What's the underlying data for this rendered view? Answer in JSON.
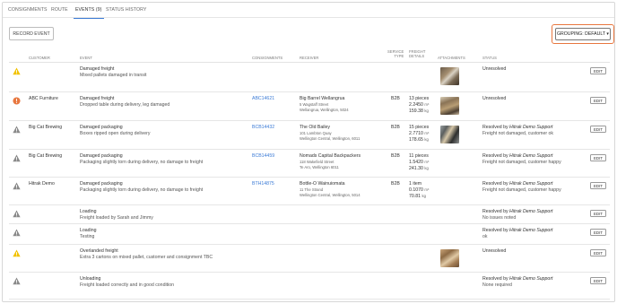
{
  "tabs": [
    {
      "label": "CONSIGNMENTS"
    },
    {
      "label": "ROUTE"
    },
    {
      "label": "EVENTS (9)"
    },
    {
      "label": "STATUS HISTORY"
    }
  ],
  "toolbar": {
    "record_event_label": "RECORD EVENT",
    "grouping_label": "GROUPING: DEFAULT ▾"
  },
  "columns": {
    "customer": "CUSTOMER",
    "event": "EVENT",
    "consignments": "CONSIGNMENTS",
    "receiver": "RECEIVER",
    "service_type_1": "SERVICE",
    "service_type_2": "TYPE",
    "freight_details_1": "FREIGHT",
    "freight_details_2": "DETAILS",
    "attachments": "ATTACHMENTS",
    "status": "STATUS"
  },
  "colors": {
    "warning": "#f2c200",
    "error": "#e8773f",
    "neutral": "#8a8a8a",
    "link": "#3b7bd6",
    "highlight": "#e8773f"
  },
  "edit_label": "EDIT",
  "rows": [
    {
      "icon": "warning-icon",
      "customer": "",
      "event_title": "Damaged freight",
      "event_desc": "Mixed pallets damaged in transit",
      "consignment": "",
      "receiver_name": "",
      "receiver_line1": "",
      "receiver_line2": "",
      "service_type": "",
      "freight_pieces": "",
      "freight_volume": "",
      "freight_weight": "",
      "has_attachment": true,
      "status_line1": "Unresolved",
      "status_line2": ""
    },
    {
      "icon": "error-icon",
      "customer": "ABC Furniture",
      "event_title": "Damaged freight",
      "event_desc": "Dropped table during delivery, leg damaged",
      "consignment": "ABC14621",
      "receiver_name": "Big Barrel Wellangrua",
      "receiver_line1": "5 Wagstaff Street",
      "receiver_line2": "Wellangrua, Wellington, 5024",
      "service_type": "B2B",
      "freight_pieces": "13 pieces",
      "freight_volume": "2.2450",
      "freight_weight": "159.38",
      "has_attachment": true,
      "status_line1": "Unresolved",
      "status_line2": ""
    },
    {
      "icon": "neutral-icon",
      "customer": "Big Cat Brewing",
      "event_title": "Damaged packaging",
      "event_desc": "Boxes ripped open during delivery",
      "consignment": "BCB14432",
      "receiver_name": "The Old Bailey",
      "receiver_line1": "101 Lambton Quay",
      "receiver_line2": "Wellington Central, Wellington, 6011",
      "service_type": "B2B",
      "freight_pieces": "15 pieces",
      "freight_volume": "2.7710",
      "freight_weight": "178.65",
      "has_attachment": true,
      "status_line1": "Resolved by",
      "status_by": "Hitrak Demo Support",
      "status_line2": "Freight not damaged, customer ok"
    },
    {
      "icon": "neutral-icon",
      "customer": "Big Cat Brewing",
      "event_title": "Damaged packaging",
      "event_desc": "Packaging slightly torn during delivery, no damage to freight",
      "consignment": "BCB14459",
      "receiver_name": "Nomads Capital Backpackers",
      "receiver_line1": "118 Wakefield Street",
      "receiver_line2": "Te Aro, Wellington 6011",
      "service_type": "B2B",
      "freight_pieces": "11 pieces",
      "freight_volume": "1.5420",
      "freight_weight": "241.30",
      "has_attachment": false,
      "status_line1": "Resolved by",
      "status_by": "Hitrak Demo Support",
      "status_line2": "Freight not damaged, customer happy"
    },
    {
      "icon": "neutral-icon",
      "customer": "Hitrak Demo",
      "event_title": "Damaged packaging",
      "event_desc": "Packaging slightly torn during delivery, no damage to freight",
      "consignment": "BTH14875",
      "receiver_name": "Bottle-O Wainuiomata",
      "receiver_line1": "11 The Strand",
      "receiver_line2": "Wellington Central, Wellington, 5014",
      "service_type": "B2B",
      "freight_pieces": "1 item",
      "freight_volume": "0.1070",
      "freight_weight": "70.81",
      "has_attachment": false,
      "status_line1": "Resolved by",
      "status_by": "Hitrak Demo Support",
      "status_line2": "Freight not damaged, customer happy"
    },
    {
      "icon": "neutral-icon",
      "customer": "",
      "event_title": "Loading",
      "event_desc": "Freight loaded by Sarah and Jimmy",
      "consignment": "",
      "receiver_name": "",
      "receiver_line1": "",
      "receiver_line2": "",
      "service_type": "",
      "freight_pieces": "",
      "freight_volume": "",
      "freight_weight": "",
      "has_attachment": false,
      "status_line1": "Resolved by",
      "status_by": "Hitrak Demo Support",
      "status_line2": "No issues noted"
    },
    {
      "icon": "neutral-icon",
      "customer": "",
      "event_title": "Loading",
      "event_desc": "Testing",
      "consignment": "",
      "receiver_name": "",
      "receiver_line1": "",
      "receiver_line2": "",
      "service_type": "",
      "freight_pieces": "",
      "freight_volume": "",
      "freight_weight": "",
      "has_attachment": false,
      "status_line1": "Resolved by",
      "status_by": "Hitrak Demo Support",
      "status_line2": "ok"
    },
    {
      "icon": "warning-icon",
      "customer": "",
      "event_title": "Overlanded freight",
      "event_desc": "Extra 3 cartons on mixed pallet, customer and consignment TBC",
      "consignment": "",
      "receiver_name": "",
      "receiver_line1": "",
      "receiver_line2": "",
      "service_type": "",
      "freight_pieces": "",
      "freight_volume": "",
      "freight_weight": "",
      "has_attachment": true,
      "status_line1": "Unresolved",
      "status_line2": ""
    },
    {
      "icon": "neutral-icon",
      "customer": "",
      "event_title": "Unloading",
      "event_desc": "Freight loaded correctly and in good condition",
      "consignment": "",
      "receiver_name": "",
      "receiver_line1": "",
      "receiver_line2": "",
      "service_type": "",
      "freight_pieces": "",
      "freight_volume": "",
      "freight_weight": "",
      "has_attachment": false,
      "status_line1": "Resolved by",
      "status_by": "Hitrak Demo Support",
      "status_line2": "None required"
    }
  ],
  "units": {
    "volume": "m³",
    "weight": "kg"
  }
}
